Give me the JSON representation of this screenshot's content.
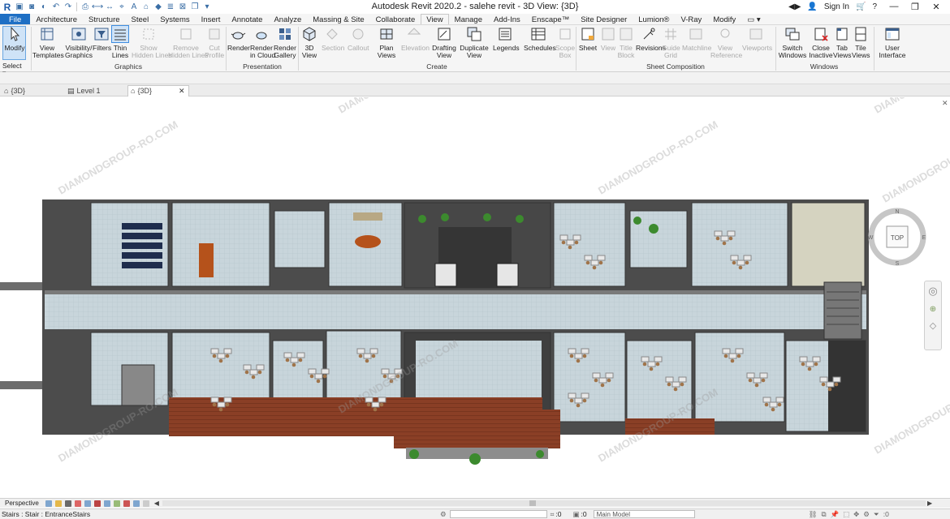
{
  "app": {
    "title": "Autodesk Revit 2020.2 - salehe revit - 3D View: {3D}",
    "sign_in": "Sign In",
    "logo": "R"
  },
  "menu_tabs": [
    "File",
    "Architecture",
    "Structure",
    "Steel",
    "Systems",
    "Insert",
    "Annotate",
    "Analyze",
    "Massing & Site",
    "Collaborate",
    "View",
    "Manage",
    "Add-Ins",
    "Enscape™",
    "Site Designer",
    "Lumion®",
    "V-Ray",
    "Modify"
  ],
  "active_tab": "View",
  "ribbon": {
    "modify": "Modify",
    "select": "Select ▾",
    "graphics": {
      "label": "Graphics",
      "view_templates": "View\nTemplates",
      "visibility": "Visibility/\nGraphics",
      "filters": "Filters",
      "thin_lines": "Thin\nLines",
      "show_hidden": "Show\nHidden Lines",
      "remove_hidden": "Remove\nHidden Lines",
      "cut_profile": "Cut\nProfile"
    },
    "presentation": {
      "label": "Presentation",
      "render": "Render",
      "render_cloud": "Render\nin Cloud",
      "render_gallery": "Render\nGallery"
    },
    "create": {
      "label": "Create",
      "view_3d": "3D\nView",
      "section": "Section",
      "callout": "Callout",
      "plan_views": "Plan\nViews",
      "elevation": "Elevation",
      "drafting_view": "Drafting\nView",
      "duplicate_view": "Duplicate\nView",
      "legends": "Legends",
      "schedules": "Schedules",
      "scope_box": "Scope\nBox"
    },
    "sheet_composition": {
      "label": "Sheet Composition",
      "sheet": "Sheet",
      "view": "View",
      "title_block": "Title\nBlock",
      "revisions": "Revisions",
      "guide_grid": "Guide\nGrid",
      "matchline": "Matchline",
      "view_reference": "View\nReference",
      "viewports": "Viewports"
    },
    "windows": {
      "label": "Windows",
      "switch_windows": "Switch\nWindows",
      "close_inactive": "Close\nInactive",
      "tab_views": "Tab\nViews",
      "tile_views": "Tile\nViews"
    },
    "user_interface": "User\nInterface"
  },
  "view_tabs": [
    {
      "label": "{3D}"
    },
    {
      "label": "Level 1"
    },
    {
      "label": "{3D}",
      "current": true
    }
  ],
  "viewcube": {
    "face": "TOP",
    "n": "N",
    "s": "S",
    "e": "E",
    "w": "W"
  },
  "watermark": "DIAMONDGROUP-RO.COM",
  "view_control": {
    "mode": "Perspective"
  },
  "status": {
    "text": "Stairs : Stair : EntranceStairs",
    "workset": ":0",
    "model": "Main Model",
    "filter": ":0"
  },
  "colors": {
    "accent": "#1e6fc4",
    "floor": "#c9d6dd",
    "wall": "#5a5a5a",
    "deck": "#7a3a24",
    "plant": "#3c8a2e"
  }
}
